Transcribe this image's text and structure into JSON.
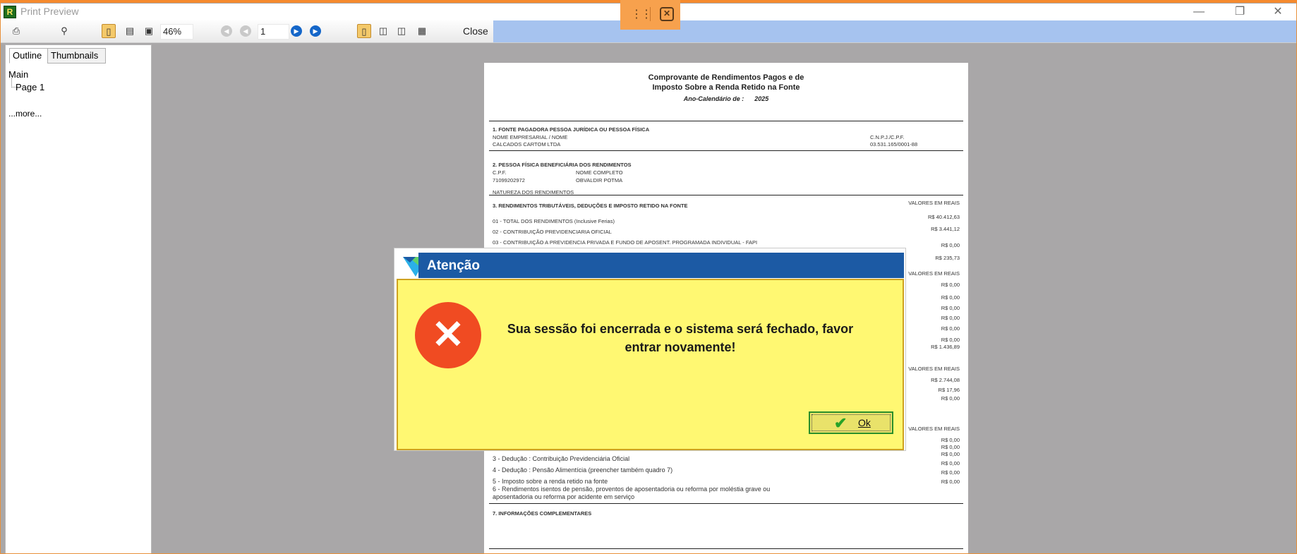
{
  "window": {
    "title": "Print Preview"
  },
  "toolbar": {
    "zoom": "46%",
    "page": "1",
    "close_label": "Close"
  },
  "sidebar": {
    "tabs": [
      "Outline",
      "Thumbnails"
    ],
    "tree": [
      "Main",
      "Page 1"
    ],
    "more": "...more..."
  },
  "document": {
    "title_line1": "Comprovante de Rendimentos Pagos e de",
    "title_line2": "Imposto Sobre a Renda Retido na Fonte",
    "year_label": "Ano-Calendário de :",
    "year": "2025",
    "s1": {
      "heading": "1. FONTE PAGADORA PESSOA JURÍDICA OU PESSOA FÍSICA",
      "name_label": "NOME EMPRESARIAL / NOME",
      "name": "CALCADOS CARTOM LTDA",
      "cnpj_label": "C.N.P.J./C.P.F.",
      "cnpj": "03.531.165/0001-88"
    },
    "s2": {
      "heading": "2. PESSOA FÍSICA BENEFICIÁRIA DOS RENDIMENTOS",
      "cpf_label": "C.P.F.",
      "cpf": "71099202972",
      "name_label": "NOME COMPLETO",
      "name": "OBVALDIR POTMA",
      "nature": "NATUREZA DOS RENDIMENTOS"
    },
    "s3": {
      "heading": "3. RENDIMENTOS TRIBUTÁVEIS, DEDUÇÕES E IMPOSTO RETIDO NA FONTE",
      "values_header": "VALORES EM REAIS",
      "lines": [
        "01 - TOTAL DOS RENDIMENTOS (Inclusive Ferias)",
        "02 - CONTRIBUIÇÃO PREVIDENCIARIA OFICIAL",
        "03 - CONTRIBUIÇÃO A PREVIDENCIA PRIVADA E FUNDO DE APOSENT. PROGRAMADA INDIVIDUAL - FAPI"
      ],
      "values": [
        "R$ 40.412,63",
        "R$ 3.441,12",
        "R$ 0,00",
        "R$ 235,73"
      ]
    },
    "right_col": {
      "h1": "VALORES EM REAIS",
      "v1": [
        "R$ 0,00",
        "R$ 0,00",
        "R$ 0,00",
        "R$ 0,00",
        "R$ 0,00",
        "R$ 0,00",
        "R$ 1.436,89"
      ],
      "h2": "VALORES EM REAIS",
      "v2": [
        "R$ 2.744,08",
        "R$ 17,96",
        "R$ 0,00"
      ],
      "h3": "VALORES EM REAIS",
      "v3": [
        "R$ 0,00",
        "R$ 0,00",
        "R$ 0,00",
        "R$ 0,00",
        "R$ 0,00",
        "R$ 0,00"
      ]
    },
    "s6_lines": [
      "3 - Dedução : Contribuição Previdenciária Oficial",
      "4 - Dedução : Pensão Alimentícia (preencher também quadro 7)",
      "5 - Imposto sobre a renda retido na fonte",
      "6 - Rendimentos isentos de pensão, proventos de aposentadoria ou reforma por moléstia grave ou",
      "aposentadoria ou reforma por acidente em serviço"
    ],
    "s7": {
      "heading": "7. INFORMAÇÕES COMPLEMENTARES"
    }
  },
  "dialog": {
    "title": "Atenção",
    "message": "Sua sessão foi encerrada e o sistema será fechado, favor entrar novamente!",
    "ok_label": "Ok",
    "colors": {
      "title_bar": "#1c5aa4",
      "body": "#fff872",
      "error": "#f04b22"
    }
  }
}
